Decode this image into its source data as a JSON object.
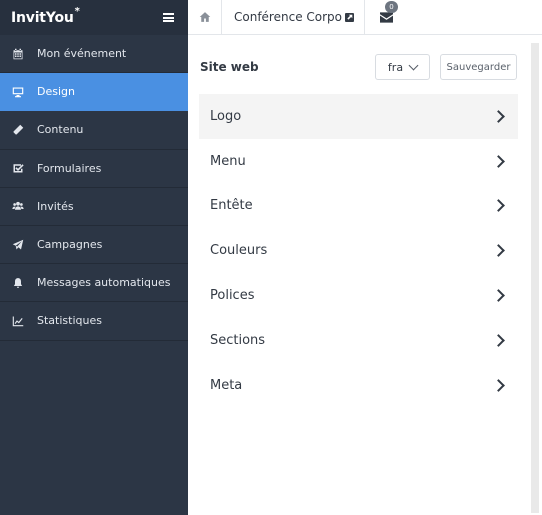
{
  "brand": {
    "name": "InvitYou",
    "star": "*"
  },
  "sidebar": {
    "items": [
      {
        "label": "Mon événement",
        "icon": "calendar-icon"
      },
      {
        "label": "Design",
        "icon": "monitor-icon",
        "active": true
      },
      {
        "label": "Contenu",
        "icon": "pencil-icon"
      },
      {
        "label": "Formulaires",
        "icon": "checkbox-icon"
      },
      {
        "label": "Invités",
        "icon": "users-icon"
      },
      {
        "label": "Campagnes",
        "icon": "paper-plane-icon"
      },
      {
        "label": "Messages automatiques",
        "icon": "bell-icon"
      },
      {
        "label": "Statistiques",
        "icon": "line-chart-icon"
      }
    ]
  },
  "topbar": {
    "event_title": "Conférence Corpo",
    "mail_count": "0"
  },
  "panel": {
    "title": "Site web",
    "language": "fra",
    "save_label": "Sauvegarder",
    "items": [
      "Logo",
      "Menu",
      "Entête",
      "Couleurs",
      "Polices",
      "Sections",
      "Meta"
    ]
  },
  "colors": {
    "sidebar_bg": "#2c3645",
    "active_accent": "#4a90e2"
  }
}
